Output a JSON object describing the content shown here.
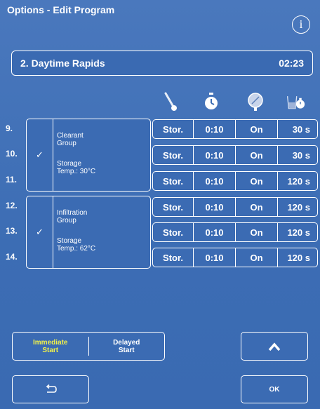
{
  "window": {
    "title": "Options - Edit Program",
    "info_label": "i"
  },
  "program": {
    "name": "2. Daytime Rapids",
    "duration": "02:23"
  },
  "columns": [
    {
      "icon": "thermometer-icon"
    },
    {
      "icon": "stopwatch-icon"
    },
    {
      "icon": "pressure-vacuum-icon"
    },
    {
      "icon": "drain-timer-icon"
    }
  ],
  "step_numbers": [
    "9.",
    "10.",
    "11.",
    "12.",
    "13.",
    "14."
  ],
  "groups": [
    {
      "check": "✓",
      "label": "Clearant\nGroup",
      "storage": "Storage\nTemp.: 30°C"
    },
    {
      "check": "✓",
      "label": "Infiltration\nGroup",
      "storage": "Storage\nTemp.: 62°C"
    }
  ],
  "rows": [
    {
      "temp": "Stor.",
      "time": "0:10",
      "pv": "On",
      "drip": "30 s"
    },
    {
      "temp": "Stor.",
      "time": "0:10",
      "pv": "On",
      "drip": "30 s"
    },
    {
      "temp": "Stor.",
      "time": "0:10",
      "pv": "On",
      "drip": "120 s"
    },
    {
      "temp": "Stor.",
      "time": "0:10",
      "pv": "On",
      "drip": "120 s"
    },
    {
      "temp": "Stor.",
      "time": "0:10",
      "pv": "On",
      "drip": "120 s"
    },
    {
      "temp": "Stor.",
      "time": "0:10",
      "pv": "On",
      "drip": "120 s"
    }
  ],
  "start": {
    "immediate_l1": "Immediate",
    "immediate_l2": "Start",
    "delayed_l1": "Delayed",
    "delayed_l2": "Start",
    "active": "immediate",
    "active_color": "#f2f24a"
  },
  "buttons": {
    "up_icon": "chevron-up-icon",
    "back_icon": "return-arrow-icon",
    "ok": "OK"
  },
  "colors": {
    "background": "#3d6fb6",
    "foreground": "#ffffff"
  }
}
